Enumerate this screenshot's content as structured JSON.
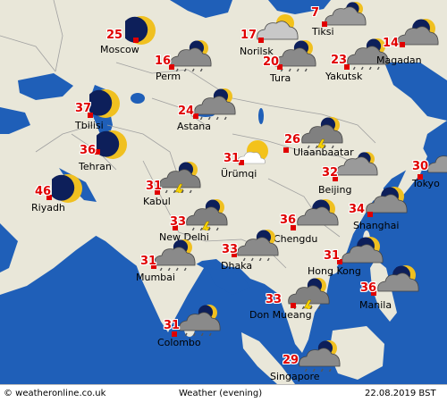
{
  "map": {
    "water_color": "#1f5fb8",
    "land_color": "#e9e7d9",
    "highlight_land_color": "#fafae8",
    "border_color": "#a0a0a0"
  },
  "cities": [
    {
      "name": "Moscow",
      "temp": "25",
      "icon": "moon-clear"
    },
    {
      "name": "Perm",
      "temp": "16",
      "icon": "cloud-rain"
    },
    {
      "name": "Norilsk",
      "temp": "17",
      "icon": "cloud-partly-sun"
    },
    {
      "name": "Tiksi",
      "temp": "7",
      "icon": "cloud-overcast"
    },
    {
      "name": "Tura",
      "temp": "20",
      "icon": "cloud-rain"
    },
    {
      "name": "Yakutsk",
      "temp": "23",
      "icon": "cloud-rain"
    },
    {
      "name": "Magadan",
      "temp": "14",
      "icon": "cloud-moon"
    },
    {
      "name": "Tbilisi",
      "temp": "37",
      "icon": "moon-clear"
    },
    {
      "name": "Astana",
      "temp": "24",
      "icon": "cloud-rain"
    },
    {
      "name": "Tehran",
      "temp": "36",
      "icon": "moon-clear"
    },
    {
      "name": "Riyadh",
      "temp": "46",
      "icon": "moon-clear"
    },
    {
      "name": "Ulaanbaatar",
      "temp": "26",
      "icon": "cloud-thunder"
    },
    {
      "name": "Ürümqi",
      "temp": "31",
      "icon": "sun-cloud"
    },
    {
      "name": "Kabul",
      "temp": "31",
      "icon": "cloud-thunder"
    },
    {
      "name": "Beijing",
      "temp": "32",
      "icon": "cloud-overcast"
    },
    {
      "name": "Tokyo",
      "temp": "30",
      "icon": "cloud-overcast"
    },
    {
      "name": "New Delhi",
      "temp": "33",
      "icon": "cloud-thunder"
    },
    {
      "name": "Chengdu",
      "temp": "36",
      "icon": "cloud-moon"
    },
    {
      "name": "Shanghai",
      "temp": "34",
      "icon": "cloud-moon"
    },
    {
      "name": "Mumbai",
      "temp": "31",
      "icon": "cloud-rain"
    },
    {
      "name": "Dhaka",
      "temp": "33",
      "icon": "cloud-rain"
    },
    {
      "name": "Hong Kong",
      "temp": "31",
      "icon": "cloud-moon"
    },
    {
      "name": "Manila",
      "temp": "36",
      "icon": "cloud-moon"
    },
    {
      "name": "Don Mueang",
      "temp": "33",
      "icon": "cloud-thunder"
    },
    {
      "name": "Colombo",
      "temp": "31",
      "icon": "cloud-rain"
    },
    {
      "name": "Singapore",
      "temp": "29",
      "icon": "cloud-rain"
    }
  ],
  "footer": {
    "source": "© weatheronline.co.uk",
    "title": "Weather (evening)",
    "date": "22.08.2019 BST"
  }
}
